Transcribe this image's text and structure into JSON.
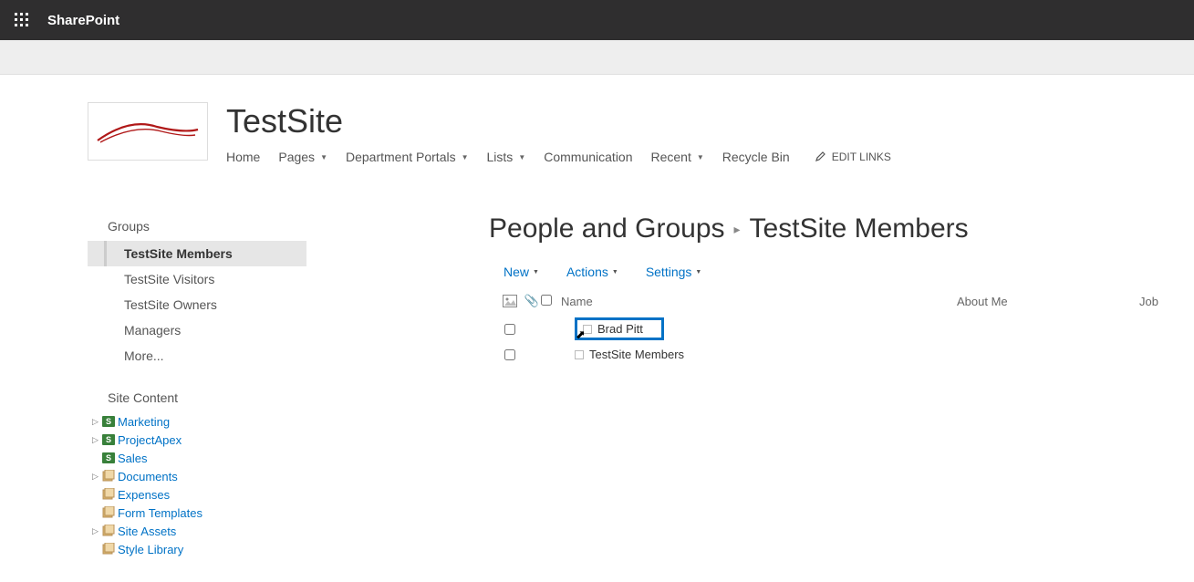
{
  "suitebar": {
    "brand": "SharePoint"
  },
  "site": {
    "title": "TestSite"
  },
  "topnav": {
    "home": "Home",
    "pages": "Pages",
    "dept": "Department Portals",
    "lists": "Lists",
    "comm": "Communication",
    "recent": "Recent",
    "recycle": "Recycle Bin",
    "edit_links": "EDIT LINKS"
  },
  "leftnav": {
    "groups_header": "Groups",
    "groups": {
      "members": "TestSite Members",
      "visitors": "TestSite Visitors",
      "owners": "TestSite Owners",
      "managers": "Managers",
      "more": "More..."
    },
    "site_content_header": "Site Content",
    "sites": {
      "marketing": "Marketing",
      "projectapex": "ProjectApex",
      "sales": "Sales"
    },
    "libs": {
      "documents": "Documents",
      "expenses": "Expenses",
      "form_templates": "Form Templates",
      "site_assets": "Site Assets",
      "style_library": "Style Library"
    }
  },
  "breadcrumb": {
    "root": "People and Groups",
    "current": "TestSite Members"
  },
  "toolbar": {
    "new": "New",
    "actions": "Actions",
    "settings": "Settings"
  },
  "columns": {
    "name": "Name",
    "about": "About Me",
    "job": "Job"
  },
  "rows": [
    {
      "name": "Brad Pitt",
      "highlighted": true
    },
    {
      "name": "TestSite Members",
      "highlighted": false
    }
  ]
}
